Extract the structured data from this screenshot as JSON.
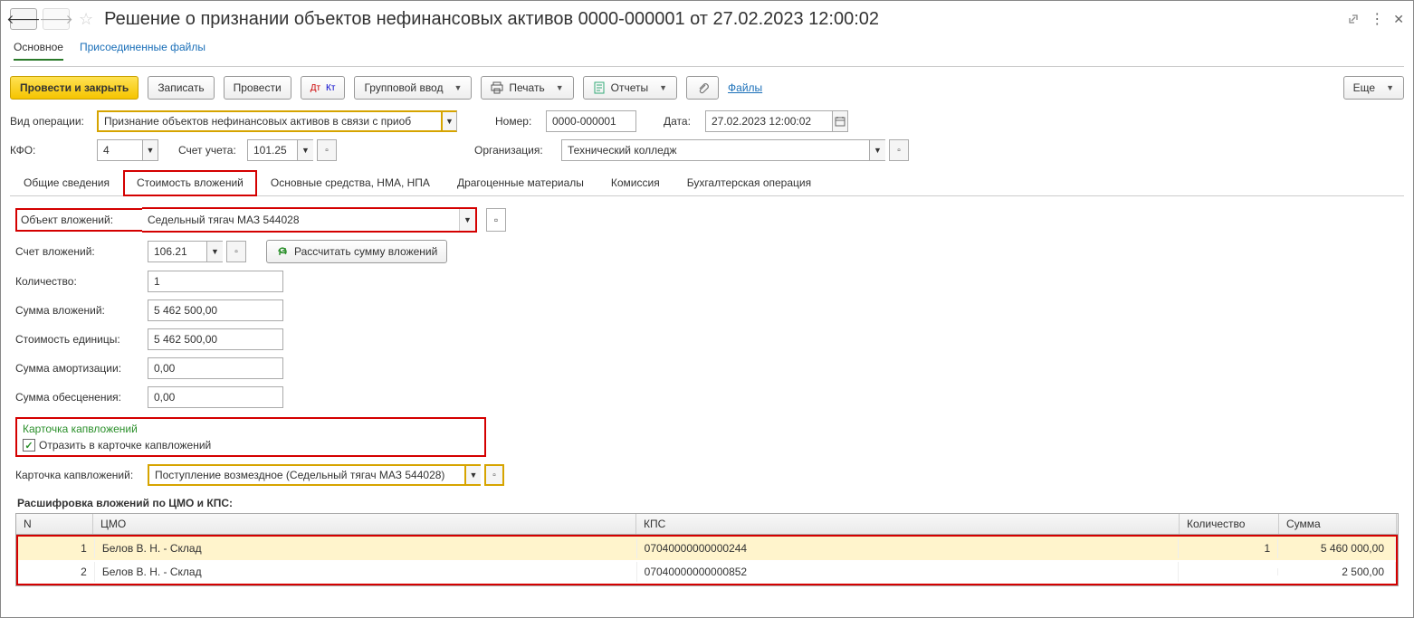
{
  "header": {
    "title": "Решение о признании объектов нефинансовых активов 0000-000001 от 27.02.2023 12:00:02"
  },
  "nav": {
    "main_tab": "Основное",
    "attached_files": "Присоединенные файлы"
  },
  "toolbar": {
    "post_close": "Провести и закрыть",
    "save": "Записать",
    "post": "Провести",
    "group_input": "Групповой ввод",
    "print": "Печать",
    "reports": "Отчеты",
    "files": "Файлы",
    "more": "Еще"
  },
  "form": {
    "op_label": "Вид операции:",
    "op_value": "Признание объектов нефинансовых активов в связи с приоб",
    "num_label": "Номер:",
    "num_value": "0000-000001",
    "date_label": "Дата:",
    "date_value": "27.02.2023 12:00:02",
    "kfo_label": "КФО:",
    "kfo_value": "4",
    "acct_label": "Счет учета:",
    "acct_value": "101.25",
    "org_label": "Организация:",
    "org_value": "Технический колледж"
  },
  "tabs": {
    "t1": "Общие сведения",
    "t2": "Стоимость вложений",
    "t3": "Основные средства, НМА, НПА",
    "t4": "Драгоценные материалы",
    "t5": "Комиссия",
    "t6": "Бухгалтерская операция"
  },
  "invest": {
    "object_label": "Объект вложений:",
    "object_value": "Седельный тягач МАЗ 544028",
    "acct_label": "Счет вложений:",
    "acct_value": "106.21",
    "recalc_btn": "Рассчитать сумму вложений",
    "qty_label": "Количество:",
    "qty_value": "1",
    "sum_label": "Сумма вложений:",
    "sum_value": "5 462 500,00",
    "unit_label": "Стоимость единицы:",
    "unit_value": "5 462 500,00",
    "amort_label": "Сумма амортизации:",
    "amort_value": "0,00",
    "impair_label": "Сумма обесценения:",
    "impair_value": "0,00",
    "card_head": "Карточка капвложений",
    "card_check": "Отразить в карточке капвложений",
    "card_label": "Карточка капвложений:",
    "card_value": "Поступление возмездное (Седельный тягач МАЗ 544028)"
  },
  "grid": {
    "title": "Расшифровка вложений по ЦМО и КПС:",
    "col_n": "N",
    "col_cmo": "ЦМО",
    "col_kps": "КПС",
    "col_qty": "Количество",
    "col_sum": "Сумма",
    "rows": [
      {
        "n": "1",
        "cmo": "Белов В. Н. - Склад",
        "kps": "07040000000000244",
        "qty": "1",
        "sum": "5 460 000,00"
      },
      {
        "n": "2",
        "cmo": "Белов В. Н. - Склад",
        "kps": "07040000000000852",
        "qty": "",
        "sum": "2 500,00"
      }
    ]
  }
}
